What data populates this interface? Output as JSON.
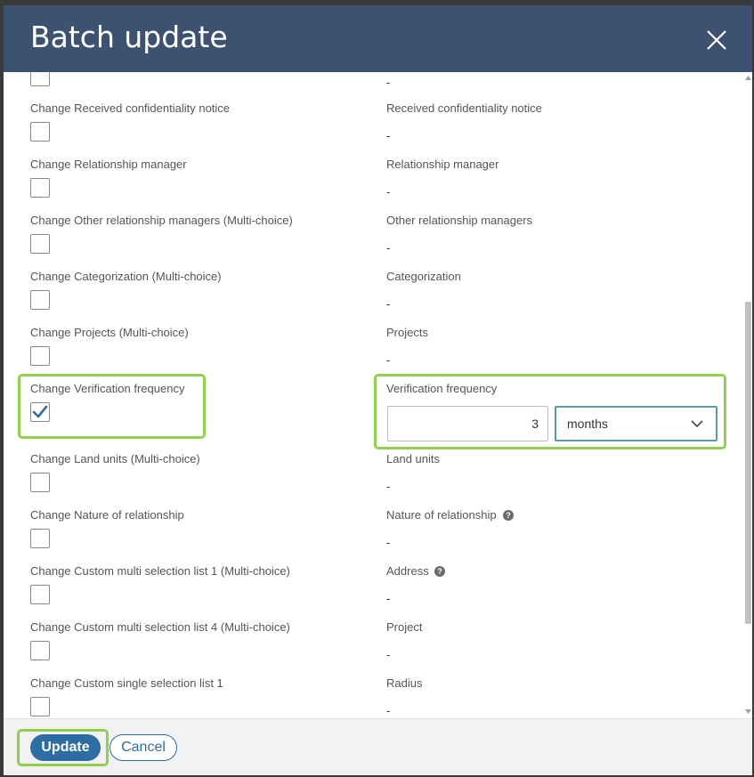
{
  "modal": {
    "title": "Batch update",
    "close_icon": "close-icon"
  },
  "rows": [
    {
      "left_label": "",
      "right_label": "",
      "value": "-",
      "checked": false
    },
    {
      "left_label": "Change Received confidentiality notice",
      "right_label": "Received confidentiality notice",
      "value": "-",
      "checked": false
    },
    {
      "left_label": "Change Relationship manager",
      "right_label": "Relationship manager",
      "value": "-",
      "checked": false
    },
    {
      "left_label": "Change Other relationship managers (Multi-choice)",
      "right_label": "Other relationship managers",
      "value": "-",
      "checked": false
    },
    {
      "left_label": "Change Categorization (Multi-choice)",
      "right_label": "Categorization",
      "value": "-",
      "checked": false
    },
    {
      "left_label": "Change Projects (Multi-choice)",
      "right_label": "Projects",
      "value": "-",
      "checked": false
    },
    {
      "left_label": "Change Verification frequency",
      "right_label": "Verification frequency",
      "checked": true,
      "input_value": "3",
      "unit_selected": "months"
    },
    {
      "left_label": "Change Land units (Multi-choice)",
      "right_label": "Land units",
      "value": "-",
      "checked": false
    },
    {
      "left_label": "Change Nature of relationship",
      "right_label": "Nature of relationship",
      "value": "-",
      "checked": false,
      "help_icon": "question-circle-icon"
    },
    {
      "left_label": "Change Custom multi selection list 1 (Multi-choice)",
      "right_label": "Address",
      "value": "-",
      "checked": false,
      "help_icon": "question-circle-icon"
    },
    {
      "left_label": "Change Custom multi selection list 4 (Multi-choice)",
      "right_label": "Project",
      "value": "-",
      "checked": false
    },
    {
      "left_label": "Change Custom single selection list 1",
      "right_label": "Radius",
      "value": "-",
      "checked": false
    }
  ],
  "footer": {
    "update_label": "Update",
    "cancel_label": "Cancel"
  },
  "colors": {
    "header_bg": "#3d5170",
    "primary": "#2e6da4",
    "highlight": "#8fd14f"
  }
}
